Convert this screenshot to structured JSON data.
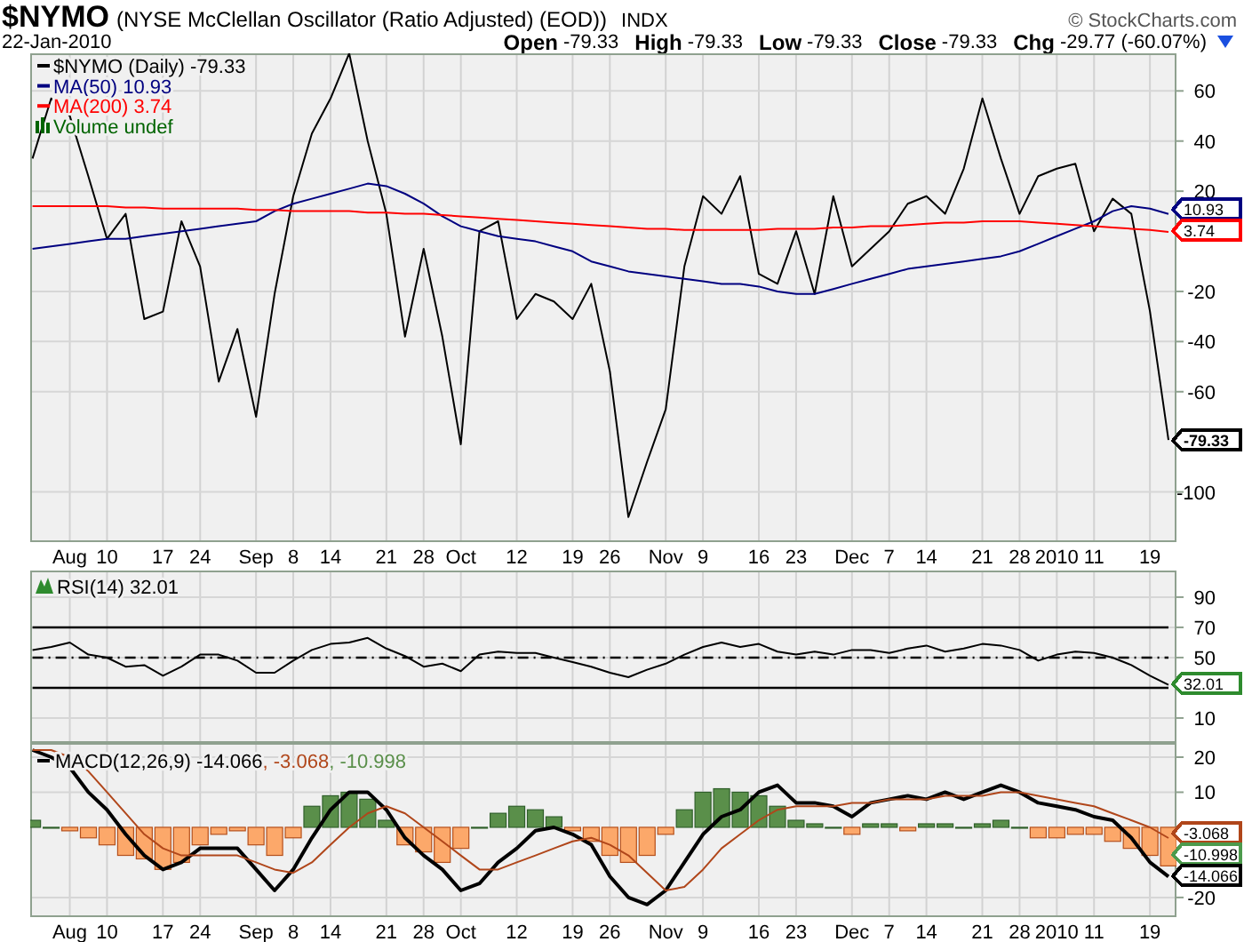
{
  "header": {
    "symbol": "$NYMO",
    "name": "(NYSE McClellan Oscillator (Ratio Adjusted) (EOD))",
    "exchange": "INDX",
    "copyright": "© StockCharts.com",
    "date": "22-Jan-2010",
    "quote": [
      {
        "label": "Open",
        "value": "-79.33"
      },
      {
        "label": "High",
        "value": "-79.33"
      },
      {
        "label": "Low",
        "value": "-79.33"
      },
      {
        "label": "Close",
        "value": "-79.33"
      },
      {
        "label": "Chg",
        "value": "-29.77 (-60.07%)"
      }
    ]
  },
  "panels": [
    {
      "legend_values": [
        "-79.33",
        "10.93",
        "3.74"
      ],
      "volume_label": "Volume undef",
      "tags": [
        {
          "text": "10.93",
          "color": "#000080",
          "bold": false
        },
        {
          "text": "3.74",
          "color": "#ff0000",
          "bold": false
        },
        {
          "text": "-79.33",
          "color": "#000000",
          "bold": true
        }
      ],
      "chart_data": {
        "type": "line",
        "grid": true,
        "ylim": [
          -120,
          75
        ],
        "categories": [
          null,
          null,
          "Aug",
          null,
          "10",
          null,
          null,
          "17",
          null,
          "24",
          null,
          null,
          "Sep",
          null,
          "8",
          null,
          "14",
          null,
          null,
          "21",
          null,
          "28",
          null,
          "Oct",
          null,
          null,
          "12",
          null,
          null,
          "19",
          null,
          "26",
          null,
          null,
          "Nov",
          null,
          "9",
          null,
          null,
          "16",
          null,
          "23",
          null,
          null,
          "Dec",
          null,
          "7",
          null,
          "14",
          null,
          null,
          "21",
          null,
          "28",
          null,
          "2010",
          null,
          "11",
          null,
          null,
          "19",
          null
        ],
        "yticks": [
          60,
          40,
          20,
          -20,
          -40,
          -60,
          -100
        ],
        "series": [
          {
            "name": "$NYMO (Daily)",
            "color": "#000000",
            "values": [
              33,
              57,
              50,
              26,
              1,
              11,
              -31,
              -28,
              8,
              -10,
              -56,
              -35,
              -70,
              -21,
              18,
              43,
              57,
              75,
              40,
              11,
              -38,
              -3,
              -38,
              -81,
              4,
              8,
              -31,
              -21,
              -24,
              -31,
              -17,
              -52,
              -110,
              -88,
              -67,
              -10,
              18,
              11,
              26,
              -13,
              -17,
              4,
              -21,
              18,
              -10,
              -3,
              4,
              15,
              18,
              11,
              29,
              57,
              33,
              11,
              26,
              29,
              31,
              4,
              17,
              11,
              -28,
              -79.33
            ]
          },
          {
            "name": "MA(50)",
            "color": "#000080",
            "values": [
              -3,
              -2,
              -1,
              0,
              1,
              1,
              2,
              3,
              4,
              5,
              6,
              7,
              8,
              12,
              15,
              17,
              19,
              21,
              23,
              22,
              19,
              15,
              10,
              6,
              4,
              2,
              1,
              0,
              -2,
              -4,
              -8,
              -10,
              -12,
              -13,
              -14,
              -15,
              -16,
              -17,
              -17,
              -18,
              -20,
              -21,
              -21,
              -19,
              -17,
              -15,
              -13,
              -11,
              -10,
              -9,
              -8,
              -7,
              -6,
              -4,
              -1,
              2,
              5,
              8,
              12,
              14,
              13,
              10.93
            ]
          },
          {
            "name": "MA(200)",
            "color": "#ff0000",
            "values": [
              14,
              14,
              14,
              14,
              14,
              13.5,
              13.5,
              13,
              13,
              13,
              13,
              13,
              12.5,
              12.5,
              12,
              12,
              12,
              12,
              11.5,
              11.5,
              11,
              11,
              10.5,
              10,
              9.5,
              9,
              8.5,
              8,
              7.5,
              7,
              6.5,
              6,
              5.5,
              5,
              5,
              4.5,
              4.5,
              4.5,
              4.5,
              4.5,
              5,
              5,
              5,
              5.5,
              5.5,
              6,
              6,
              6.5,
              7,
              7.5,
              7.5,
              8,
              8,
              8,
              7.5,
              7,
              6.5,
              6,
              5.5,
              5,
              4.5,
              3.74
            ]
          }
        ]
      }
    },
    {
      "legend_values": [
        "32.01"
      ],
      "tags": [
        {
          "text": "32.01",
          "color": "#2e8b2e",
          "bold": false
        }
      ],
      "chart_data": {
        "type": "line",
        "grid": true,
        "ylim": [
          -6.5,
          107.6
        ],
        "yticks": [
          90,
          70,
          50,
          10
        ],
        "series": [
          {
            "name": "RSI(14)",
            "color": "#000000",
            "values": [
              55,
              57,
              60,
              52,
              50,
              44,
              45,
              38,
              44,
              52,
              52,
              48,
              40,
              40,
              48,
              55,
              59,
              60,
              63,
              56,
              51,
              44,
              46,
              41,
              52,
              54,
              53,
              53,
              50,
              47,
              44,
              40,
              37,
              42,
              46,
              52,
              57,
              60,
              57,
              59,
              54,
              52,
              54,
              52,
              55,
              55,
              53,
              56,
              58,
              54,
              56,
              59,
              58,
              55,
              48,
              52,
              54,
              53,
              50,
              45,
              38,
              32.01
            ]
          },
          {
            "color": "#000000",
            "values": [
              70,
              70,
              70,
              70,
              70,
              70,
              70,
              70,
              70,
              70,
              70,
              70,
              70,
              70,
              70,
              70,
              70,
              70,
              70,
              70,
              70,
              70,
              70,
              70,
              70,
              70,
              70,
              70,
              70,
              70,
              70,
              70,
              70,
              70,
              70,
              70,
              70,
              70,
              70,
              70,
              70,
              70,
              70,
              70,
              70,
              70,
              70,
              70,
              70,
              70,
              70,
              70,
              70,
              70,
              70,
              70,
              70,
              70,
              70,
              70,
              70,
              70
            ]
          },
          {
            "color": "#000000",
            "line_style": "dashdot",
            "values": [
              50,
              50,
              50,
              50,
              50,
              50,
              50,
              50,
              50,
              50,
              50,
              50,
              50,
              50,
              50,
              50,
              50,
              50,
              50,
              50,
              50,
              50,
              50,
              50,
              50,
              50,
              50,
              50,
              50,
              50,
              50,
              50,
              50,
              50,
              50,
              50,
              50,
              50,
              50,
              50,
              50,
              50,
              50,
              50,
              50,
              50,
              50,
              50,
              50,
              50,
              50,
              50,
              50,
              50,
              50,
              50,
              50,
              50,
              50,
              50,
              50,
              50
            ]
          },
          {
            "color": "#000000",
            "values": [
              30,
              30,
              30,
              30,
              30,
              30,
              30,
              30,
              30,
              30,
              30,
              30,
              30,
              30,
              30,
              30,
              30,
              30,
              30,
              30,
              30,
              30,
              30,
              30,
              30,
              30,
              30,
              30,
              30,
              30,
              30,
              30,
              30,
              30,
              30,
              30,
              30,
              30,
              30,
              30,
              30,
              30,
              30,
              30,
              30,
              30,
              30,
              30,
              30,
              30,
              30,
              30,
              30,
              30,
              30,
              30,
              30,
              30,
              30,
              30,
              30,
              30
            ]
          }
        ]
      }
    },
    {
      "legend_values": [
        "-14.066",
        ", -3.068",
        ", -10.998"
      ],
      "tags": [
        {
          "text": "-3.068",
          "color": "#b0461a",
          "bold": false
        },
        {
          "text": "-10.998",
          "color": "#4c9a4c",
          "bold": false
        },
        {
          "text": "-14.066",
          "color": "#000000",
          "bold": false
        }
      ],
      "chart_data": {
        "type": "line",
        "grid": true,
        "ylim": [
          -25.6,
          24.05
        ],
        "categories": [
          null,
          null,
          "Aug",
          null,
          "10",
          null,
          null,
          "17",
          null,
          "24",
          null,
          null,
          "Sep",
          null,
          "8",
          null,
          "14",
          null,
          null,
          "21",
          null,
          "28",
          null,
          "Oct",
          null,
          null,
          "12",
          null,
          null,
          "19",
          null,
          "26",
          null,
          null,
          "Nov",
          null,
          "9",
          null,
          null,
          "16",
          null,
          "23",
          null,
          null,
          "Dec",
          null,
          "7",
          null,
          "14",
          null,
          null,
          "21",
          null,
          "28",
          null,
          "2010",
          null,
          "11",
          null,
          null,
          "19",
          null
        ],
        "yticks": [
          20,
          10,
          -20
        ],
        "series": [
          {
            "name": "MACD(12,26,9)",
            "color": "#000000",
            "values": [
              22,
              20,
              17,
              10,
              5,
              -2,
              -8,
              -12,
              -10,
              -6,
              -6,
              -6,
              -12,
              -18,
              -12,
              -3,
              5,
              10,
              10,
              5,
              -3,
              -8,
              -12,
              -18,
              -16,
              -10,
              -6,
              -1,
              0,
              -2,
              -5,
              -14,
              -20,
              -22,
              -18,
              -10,
              -2,
              3,
              5,
              10,
              12,
              7,
              7,
              6,
              3,
              7,
              8,
              9,
              8,
              10,
              8,
              10,
              12,
              10,
              7,
              6,
              5,
              3,
              2,
              -3,
              -10,
              -14.066
            ]
          },
          {
            "color": "#b0461a",
            "values": [
              22,
              22,
              20,
              16,
              10,
              4,
              -2,
              -6,
              -8,
              -8,
              -8,
              -8,
              -10,
              -12,
              -13,
              -10,
              -5,
              0,
              4,
              6,
              4,
              0,
              -4,
              -8,
              -12,
              -12,
              -10,
              -8,
              -6,
              -4,
              -3,
              -5,
              -8,
              -13,
              -18,
              -17,
              -12,
              -6,
              -2,
              2,
              5,
              6,
              6,
              6,
              7,
              7,
              8,
              8,
              8,
              9,
              9,
              9,
              10,
              10,
              9,
              8,
              7,
              6,
              4,
              2,
              0,
              -3.068
            ]
          },
          {
            "type": "bar",
            "color": "#5a8f4a",
            "values": [
              2,
              0,
              null,
              null,
              null,
              null,
              null,
              null,
              null,
              null,
              null,
              null,
              null,
              null,
              null,
              6,
              9,
              10,
              8,
              2,
              null,
              null,
              null,
              null,
              0,
              4,
              6,
              5,
              3,
              null,
              null,
              null,
              null,
              null,
              null,
              5,
              10,
              11,
              10,
              9,
              6,
              2,
              1,
              0,
              null,
              1,
              1,
              null,
              1,
              1,
              0,
              1,
              2,
              0,
              null,
              null,
              null,
              null,
              null,
              null,
              null,
              null
            ]
          },
          {
            "type": "bar",
            "color": "#fca86a",
            "values": [
              null,
              null,
              -1,
              -3,
              -5,
              -8,
              -9,
              -12,
              -10,
              -5,
              -2,
              -1,
              -5,
              -8,
              -3,
              null,
              null,
              null,
              null,
              null,
              -5,
              -7,
              -10,
              -6,
              null,
              null,
              null,
              null,
              null,
              -1,
              -4,
              -8,
              -10,
              -8,
              -2,
              null,
              null,
              null,
              null,
              null,
              null,
              null,
              null,
              null,
              -2,
              null,
              null,
              -1,
              null,
              null,
              null,
              null,
              null,
              null,
              -3,
              -3,
              -2,
              -2,
              -4,
              -6,
              -8,
              -10.998
            ]
          }
        ]
      }
    }
  ]
}
